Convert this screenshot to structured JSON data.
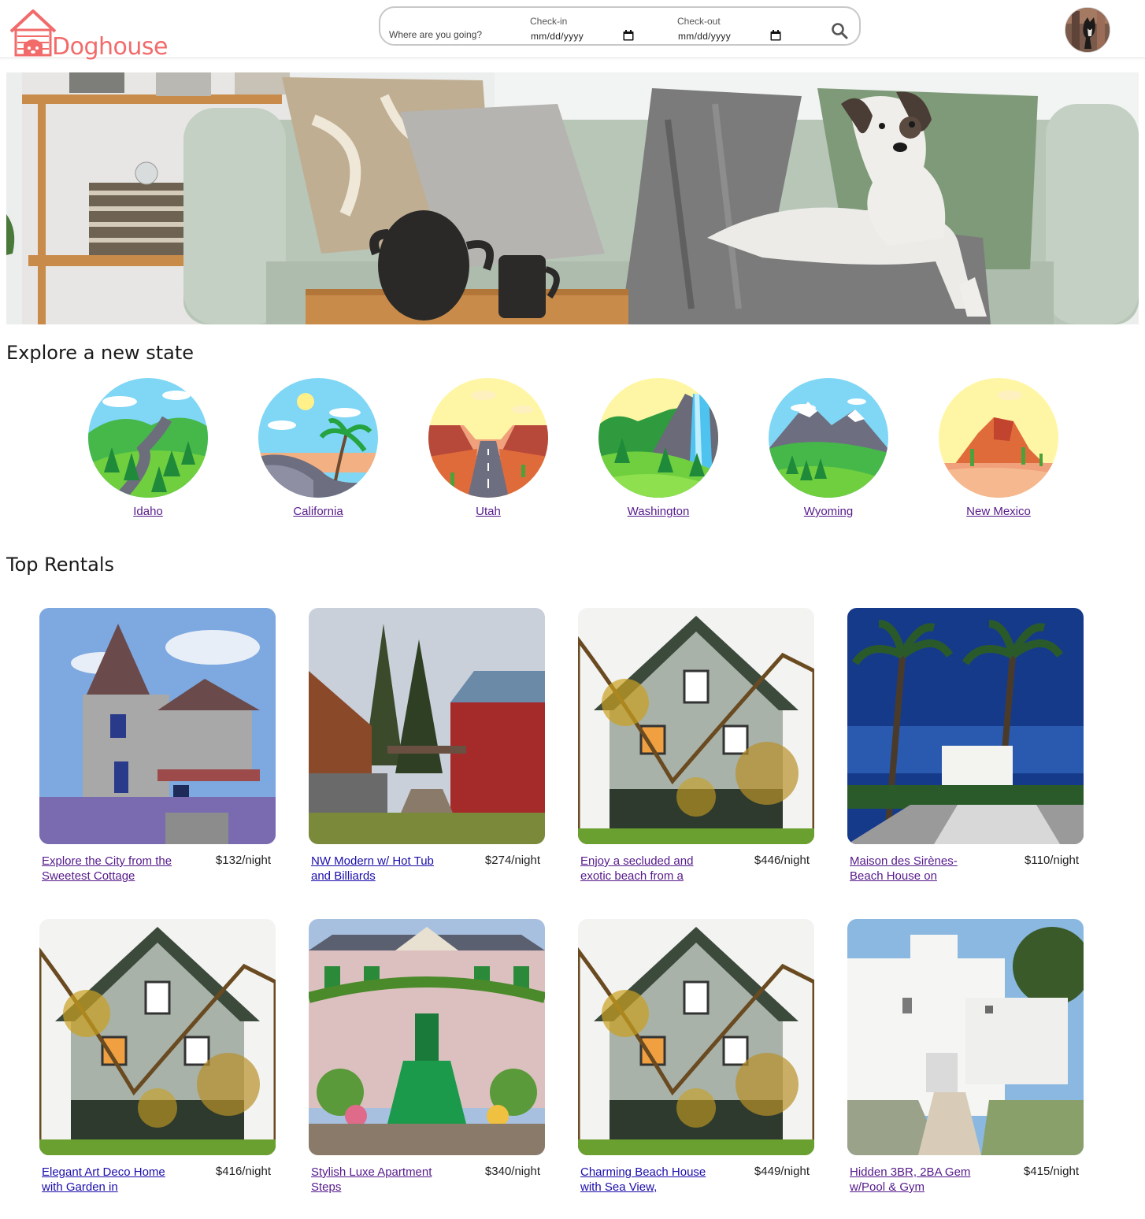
{
  "header": {
    "logo_text": "Doghouse",
    "search": {
      "where_placeholder": "Where are you going?",
      "checkin_label": "Check-in",
      "checkin_value": "mm/dd/yyyy",
      "checkout_label": "Check-out",
      "checkout_value": "mm/dd/yyyy"
    }
  },
  "states_section": {
    "title": "Explore a new state",
    "states": [
      {
        "name": "Idaho"
      },
      {
        "name": "California"
      },
      {
        "name": "Utah"
      },
      {
        "name": "Washington"
      },
      {
        "name": "Wyoming"
      },
      {
        "name": "New Mexico"
      }
    ]
  },
  "rentals_section": {
    "title": "Top Rentals",
    "rentals": [
      {
        "title": "Explore the City from the Sweetest Cottage",
        "price": "$132/night"
      },
      {
        "title": "NW Modern w/ Hot Tub and Billiards",
        "price": "$274/night"
      },
      {
        "title": "Enjoy a secluded and exotic beach from a",
        "price": "$446/night"
      },
      {
        "title": "Maison des Sirènes- Beach House on",
        "price": "$110/night"
      },
      {
        "title": "Elegant Art Deco Home with Garden in",
        "price": "$416/night"
      },
      {
        "title": "Stylish Luxe Apartment Steps",
        "price": "$340/night"
      },
      {
        "title": "Charming Beach House with Sea View,",
        "price": "$449/night"
      },
      {
        "title": "Hidden 3BR, 2BA Gem w/Pool & Gym",
        "price": "$415/night"
      }
    ]
  },
  "colors": {
    "brand": "#f26b6b",
    "link": "#1a0dab",
    "visited_link": "#551a8b"
  }
}
